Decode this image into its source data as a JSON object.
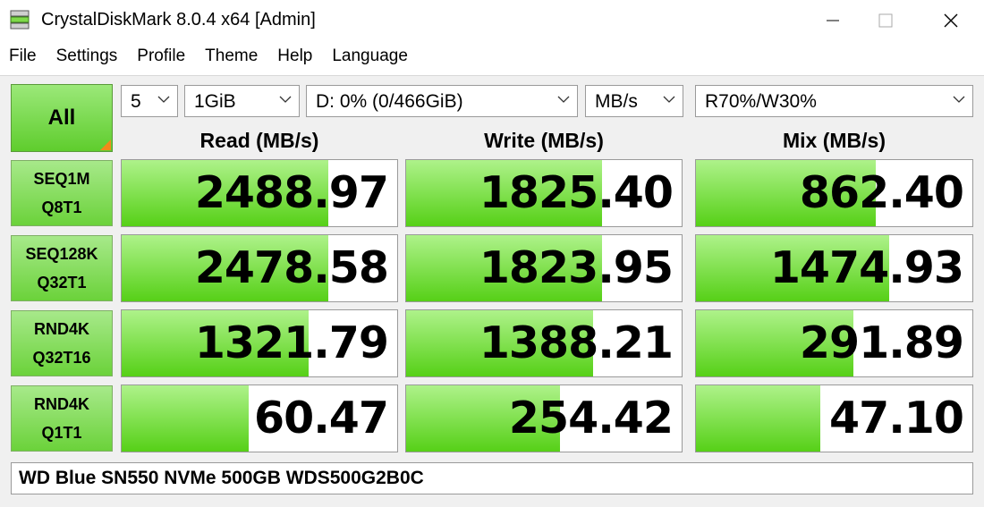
{
  "window": {
    "title": "CrystalDiskMark 8.0.4 x64 [Admin]"
  },
  "menu": [
    "File",
    "Settings",
    "Profile",
    "Theme",
    "Help",
    "Language"
  ],
  "controls": {
    "all_label": "All",
    "count": "5",
    "size": "1GiB",
    "drive": "D: 0% (0/466GiB)",
    "unit": "MB/s",
    "mix": "R70%/W30%"
  },
  "columns": [
    "Read (MB/s)",
    "Write (MB/s)",
    "Mix (MB/s)"
  ],
  "rows": [
    {
      "line1": "SEQ1M",
      "line2": "Q8T1",
      "read": "2488.97",
      "write": "1825.40",
      "mix": "862.40",
      "read_fill": 0.75,
      "write_fill": 0.71,
      "mix_fill": 0.65
    },
    {
      "line1": "SEQ128K",
      "line2": "Q32T1",
      "read": "2478.58",
      "write": "1823.95",
      "mix": "1474.93",
      "read_fill": 0.75,
      "write_fill": 0.71,
      "mix_fill": 0.7
    },
    {
      "line1": "RND4K",
      "line2": "Q32T16",
      "read": "1321.79",
      "write": "1388.21",
      "mix": "291.89",
      "read_fill": 0.68,
      "write_fill": 0.68,
      "mix_fill": 0.57
    },
    {
      "line1": "RND4K",
      "line2": "Q1T1",
      "read": "60.47",
      "write": "254.42",
      "mix": "47.10",
      "read_fill": 0.46,
      "write_fill": 0.56,
      "mix_fill": 0.45
    }
  ],
  "device": "WD Blue SN550 NVMe 500GB WDS500G2B0C",
  "colors": {
    "bar": "#56d017",
    "label": "#6bd23a",
    "accent": "#f28a1a"
  }
}
